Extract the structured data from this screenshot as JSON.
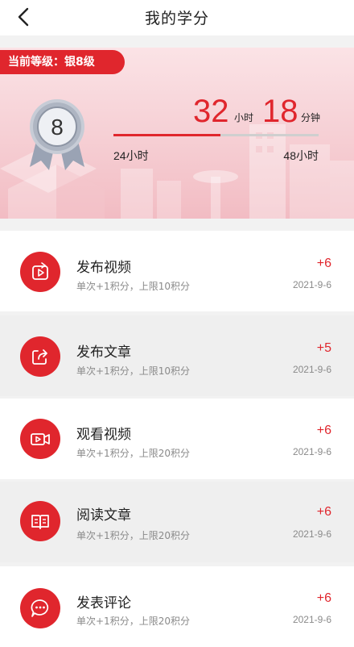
{
  "header": {
    "title": "我的学分"
  },
  "banner": {
    "level_tag": "当前等级：银8级",
    "medal_level": "8",
    "hours_value": "32",
    "hours_unit": "小时",
    "minutes_value": "18",
    "minutes_unit": "分钟",
    "progress_fraction": 0.52,
    "range_start": "24小时",
    "range_end": "48小时"
  },
  "activities": [
    {
      "icon": "share-video-icon",
      "title": "发布视频",
      "desc": "单次+1积分，上限10积分",
      "score": "+6",
      "date": "2021-9-6"
    },
    {
      "icon": "share-article-icon",
      "title": "发布文章",
      "desc": "单次+1积分，上限10积分",
      "score": "+5",
      "date": "2021-9-6"
    },
    {
      "icon": "video-camera-icon",
      "title": "观看视频",
      "desc": "单次+1积分，上限20积分",
      "score": "+6",
      "date": "2021-9-6"
    },
    {
      "icon": "book-icon",
      "title": "阅读文章",
      "desc": "单次+1积分，上限20积分",
      "score": "+6",
      "date": "2021-9-6"
    },
    {
      "icon": "comment-icon",
      "title": "发表评论",
      "desc": "单次+1积分，上限20积分",
      "score": "+6",
      "date": "2021-9-6"
    }
  ],
  "colors": {
    "accent": "#e0262d",
    "banner_light": "#fbe3e6",
    "grey_row": "#efefef"
  }
}
